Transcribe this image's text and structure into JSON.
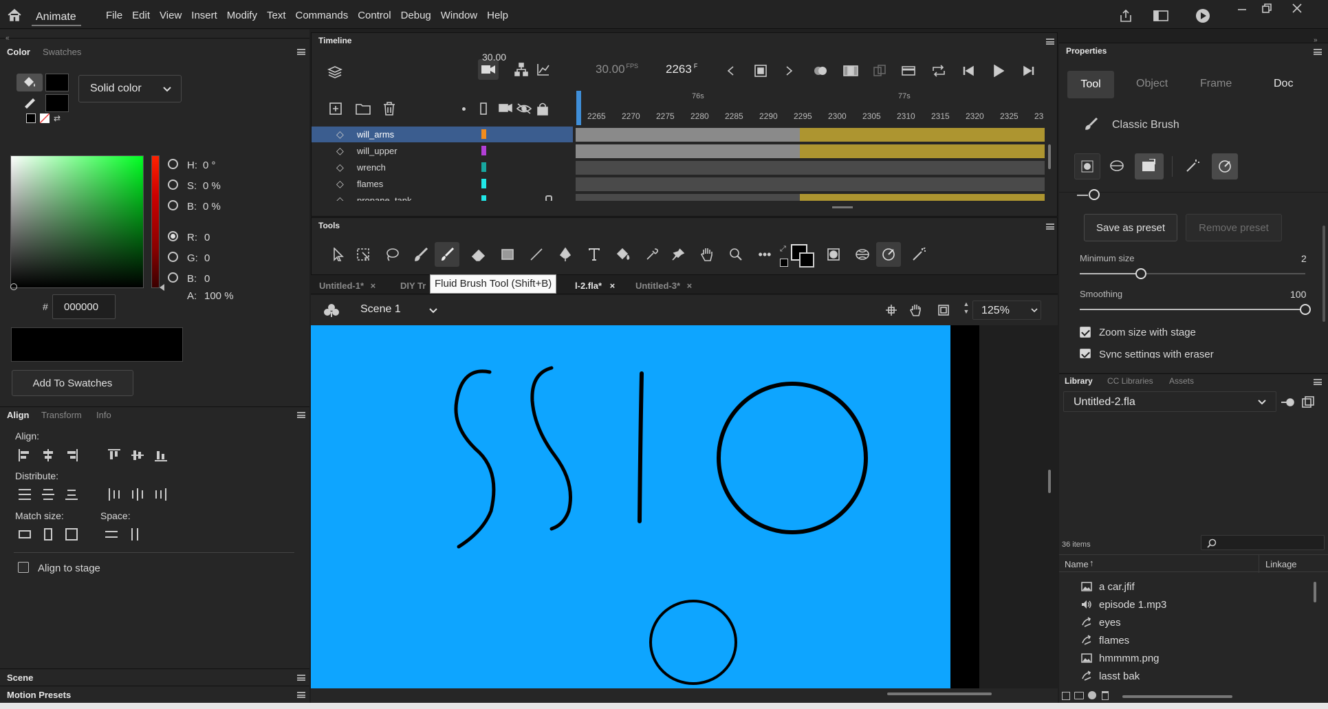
{
  "app": {
    "name": "Animate",
    "menus": [
      "File",
      "Edit",
      "View",
      "Insert",
      "Modify",
      "Text",
      "Commands",
      "Control",
      "Debug",
      "Window",
      "Help"
    ]
  },
  "color_panel": {
    "tabs": [
      "Color",
      "Swatches"
    ],
    "fill_type": "Solid color",
    "hsb": {
      "h_label": "H:",
      "h_value": "0 °",
      "s_label": "S:",
      "s_value": "0 %",
      "b_label": "B:",
      "b_value": "0 %"
    },
    "rgb": {
      "r_label": "R:",
      "r_value": "0",
      "g_label": "G:",
      "g_value": "0",
      "b_label": "B:",
      "b_value": "0"
    },
    "alpha_label": "A:",
    "alpha_value": "100 %",
    "hex_label": "#",
    "hex_value": "000000",
    "add_swatches": "Add To Swatches",
    "accent": "#00ff22"
  },
  "align_panel": {
    "tabs": [
      "Align",
      "Transform",
      "Info"
    ],
    "align_label": "Align:",
    "distribute_label": "Distribute:",
    "match_size_label": "Match size:",
    "space_label": "Space:",
    "align_to_stage": "Align to stage"
  },
  "scene_panel": {
    "title": "Scene"
  },
  "motion_presets_panel": {
    "title": "Motion Presets"
  },
  "timeline": {
    "title": "Timeline",
    "fps": "30.00",
    "fps_unit": "FPS",
    "frame": "2263",
    "frame_unit": "F",
    "seconds": [
      "76s",
      "77s"
    ],
    "ruler": [
      "2265",
      "2270",
      "2275",
      "2280",
      "2285",
      "2290",
      "2295",
      "2300",
      "2305",
      "2310",
      "2315",
      "2320",
      "2325",
      "23"
    ],
    "layers": [
      {
        "name": "will_arms",
        "color": "#f28c1c",
        "selected": true
      },
      {
        "name": "will_upper",
        "color": "#b23fd6",
        "selected": false
      },
      {
        "name": "wrench",
        "color": "#17a7a0",
        "selected": false
      },
      {
        "name": "flames",
        "color": "#20e8e8",
        "selected": false
      },
      {
        "name": "propane_tank",
        "color": "#20e8e8",
        "selected": false
      }
    ]
  },
  "tools_panel": {
    "title": "Tools",
    "tooltip": "Fluid Brush Tool (Shift+B)"
  },
  "document_tabs": [
    "Untitled-1*",
    "DIY Tr",
    "l-2.fla*",
    "Untitled-3*"
  ],
  "stage": {
    "scene": "Scene 1",
    "zoom": "125%",
    "background": "#0ea5ff"
  },
  "properties": {
    "title": "Properties",
    "tabs": [
      "Tool",
      "Object",
      "Frame",
      "Doc"
    ],
    "tool_name": "Classic Brush",
    "save_preset": "Save as preset",
    "remove_preset": "Remove preset",
    "minimum_size_label": "Minimum size",
    "minimum_size_value": "2",
    "minimum_size_fraction": 0.27,
    "smoothing_label": "Smoothing",
    "smoothing_value": "100",
    "smoothing_fraction": 1.0,
    "zoom_size_label": "Zoom size with stage",
    "sync_label": "Sync settings with eraser"
  },
  "library": {
    "tabs": [
      "Library",
      "CC Libraries",
      "Assets"
    ],
    "document": "Untitled-2.fla",
    "count": "36 items",
    "col_name": "Name",
    "col_linkage": "Linkage",
    "items": [
      {
        "name": "a car.jfif",
        "icon": "image-icon"
      },
      {
        "name": "episode 1.mp3",
        "icon": "sound-icon"
      },
      {
        "name": "eyes",
        "icon": "symbol-icon"
      },
      {
        "name": "flames",
        "icon": "symbol-icon"
      },
      {
        "name": "hmmmm.png",
        "icon": "image-icon"
      },
      {
        "name": "lasst bak",
        "icon": "symbol-icon"
      }
    ]
  }
}
